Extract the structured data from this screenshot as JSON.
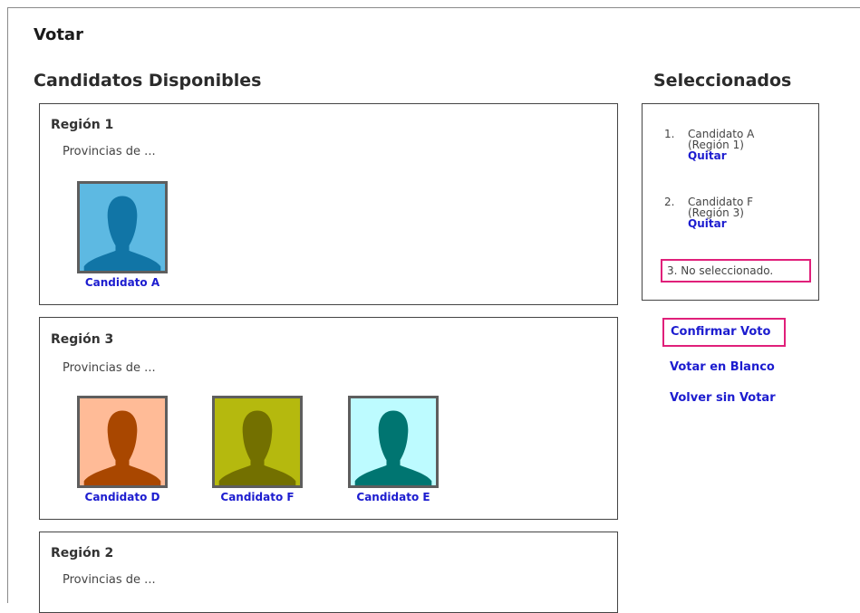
{
  "page_title": "Votar",
  "available": {
    "heading": "Candidatos Disponibles",
    "regions": [
      {
        "title": "Región 1",
        "subtitle": "Provincias de ...",
        "candidates": [
          {
            "name": "Candidato A",
            "bg": "#5db9e2",
            "fg": "#1175a6"
          }
        ]
      },
      {
        "title": "Región 3",
        "subtitle": "Provincias de ...",
        "candidates": [
          {
            "name": "Candidato D",
            "bg": "#ffbb97",
            "fg": "#a94700"
          },
          {
            "name": "Candidato F",
            "bg": "#b5b90e",
            "fg": "#737000"
          },
          {
            "name": "Candidato E",
            "bg": "#bdfbff",
            "fg": "#007571"
          }
        ]
      },
      {
        "title": "Región 2",
        "subtitle": "Provincias de ...",
        "candidates": []
      }
    ]
  },
  "selected": {
    "heading": "Seleccionados",
    "items": [
      {
        "number": "1.",
        "name": "Candidato A",
        "region": "(Región 1)",
        "remove_label": "Quitar"
      },
      {
        "number": "2.",
        "name": "Candidato F",
        "region": "(Región 3)",
        "remove_label": "Quitar"
      }
    ],
    "empty_item": {
      "number": "3.",
      "text": "No seleccionado."
    }
  },
  "actions": {
    "confirm": "Confirmar Voto",
    "blank": "Votar en Blanco",
    "back": "Volver sin Votar"
  },
  "colors": {
    "link": "#1c1ccf",
    "highlight": "#e0207a"
  }
}
